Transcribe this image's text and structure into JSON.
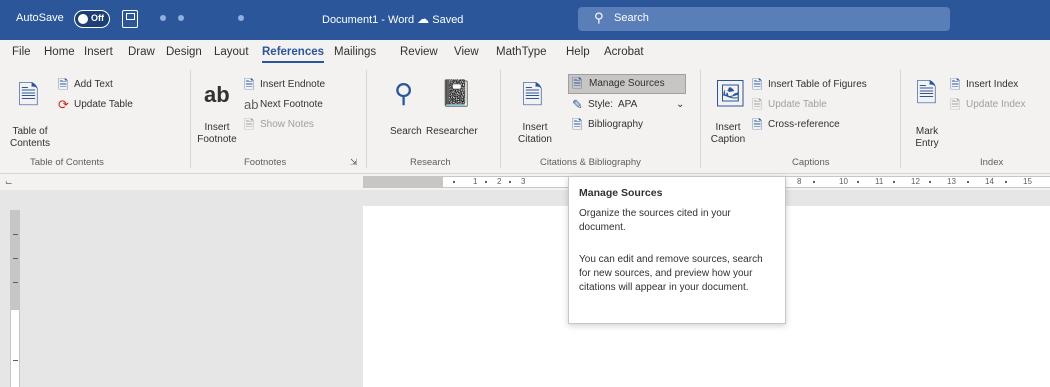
{
  "titlebar": {
    "autosave_label": "AutoSave",
    "autosave_state": "Off",
    "document_title": "Document1 - Word",
    "cloud_status": "Saved",
    "search_placeholder": "Search",
    "accent_color": "#2b579a"
  },
  "tabs": [
    {
      "label": "File"
    },
    {
      "label": "Home"
    },
    {
      "label": "Insert"
    },
    {
      "label": "Draw"
    },
    {
      "label": "Design"
    },
    {
      "label": "Layout"
    },
    {
      "label": "References",
      "active": true
    },
    {
      "label": "Mailings"
    },
    {
      "label": "Review"
    },
    {
      "label": "View"
    },
    {
      "label": "MathType"
    },
    {
      "label": "Help"
    },
    {
      "label": "Acrobat"
    }
  ],
  "ribbon": {
    "toc": {
      "label": "Table of Contents",
      "big_button": "Table of Contents",
      "add_text": "Add Text",
      "update_table": "Update Table"
    },
    "footnotes": {
      "label": "Footnotes",
      "insert_footnote": "Insert Footnote",
      "insert_endnote": "Insert Endnote",
      "next_footnote": "Next Footnote",
      "show_notes": "Show Notes"
    },
    "research": {
      "label": "Research",
      "search": "Search",
      "researcher": "Researcher"
    },
    "citations": {
      "label": "Citations & Bibliography",
      "insert_citation": "Insert Citation",
      "manage_sources": "Manage Sources",
      "style_label": "Style:",
      "style_value": "APA",
      "bibliography": "Bibliography"
    },
    "captions": {
      "label": "Captions",
      "insert_caption": "Insert Caption",
      "insert_table_of_figures": "Insert Table of Figures",
      "update_table": "Update Table",
      "cross_reference": "Cross-reference"
    },
    "index": {
      "label": "Index",
      "mark_entry": "Mark Entry",
      "insert_index": "Insert Index",
      "update_index": "Update Index"
    }
  },
  "ruler": {
    "numbers": [
      "1",
      "2",
      "3",
      "8",
      "10",
      "11",
      "12",
      "13",
      "14",
      "15"
    ]
  },
  "tooltip": {
    "title": "Manage Sources",
    "line1": "Organize the sources cited in your document.",
    "line2": "You can edit and remove sources, search for new sources, and preview how your citations will appear in your document."
  }
}
